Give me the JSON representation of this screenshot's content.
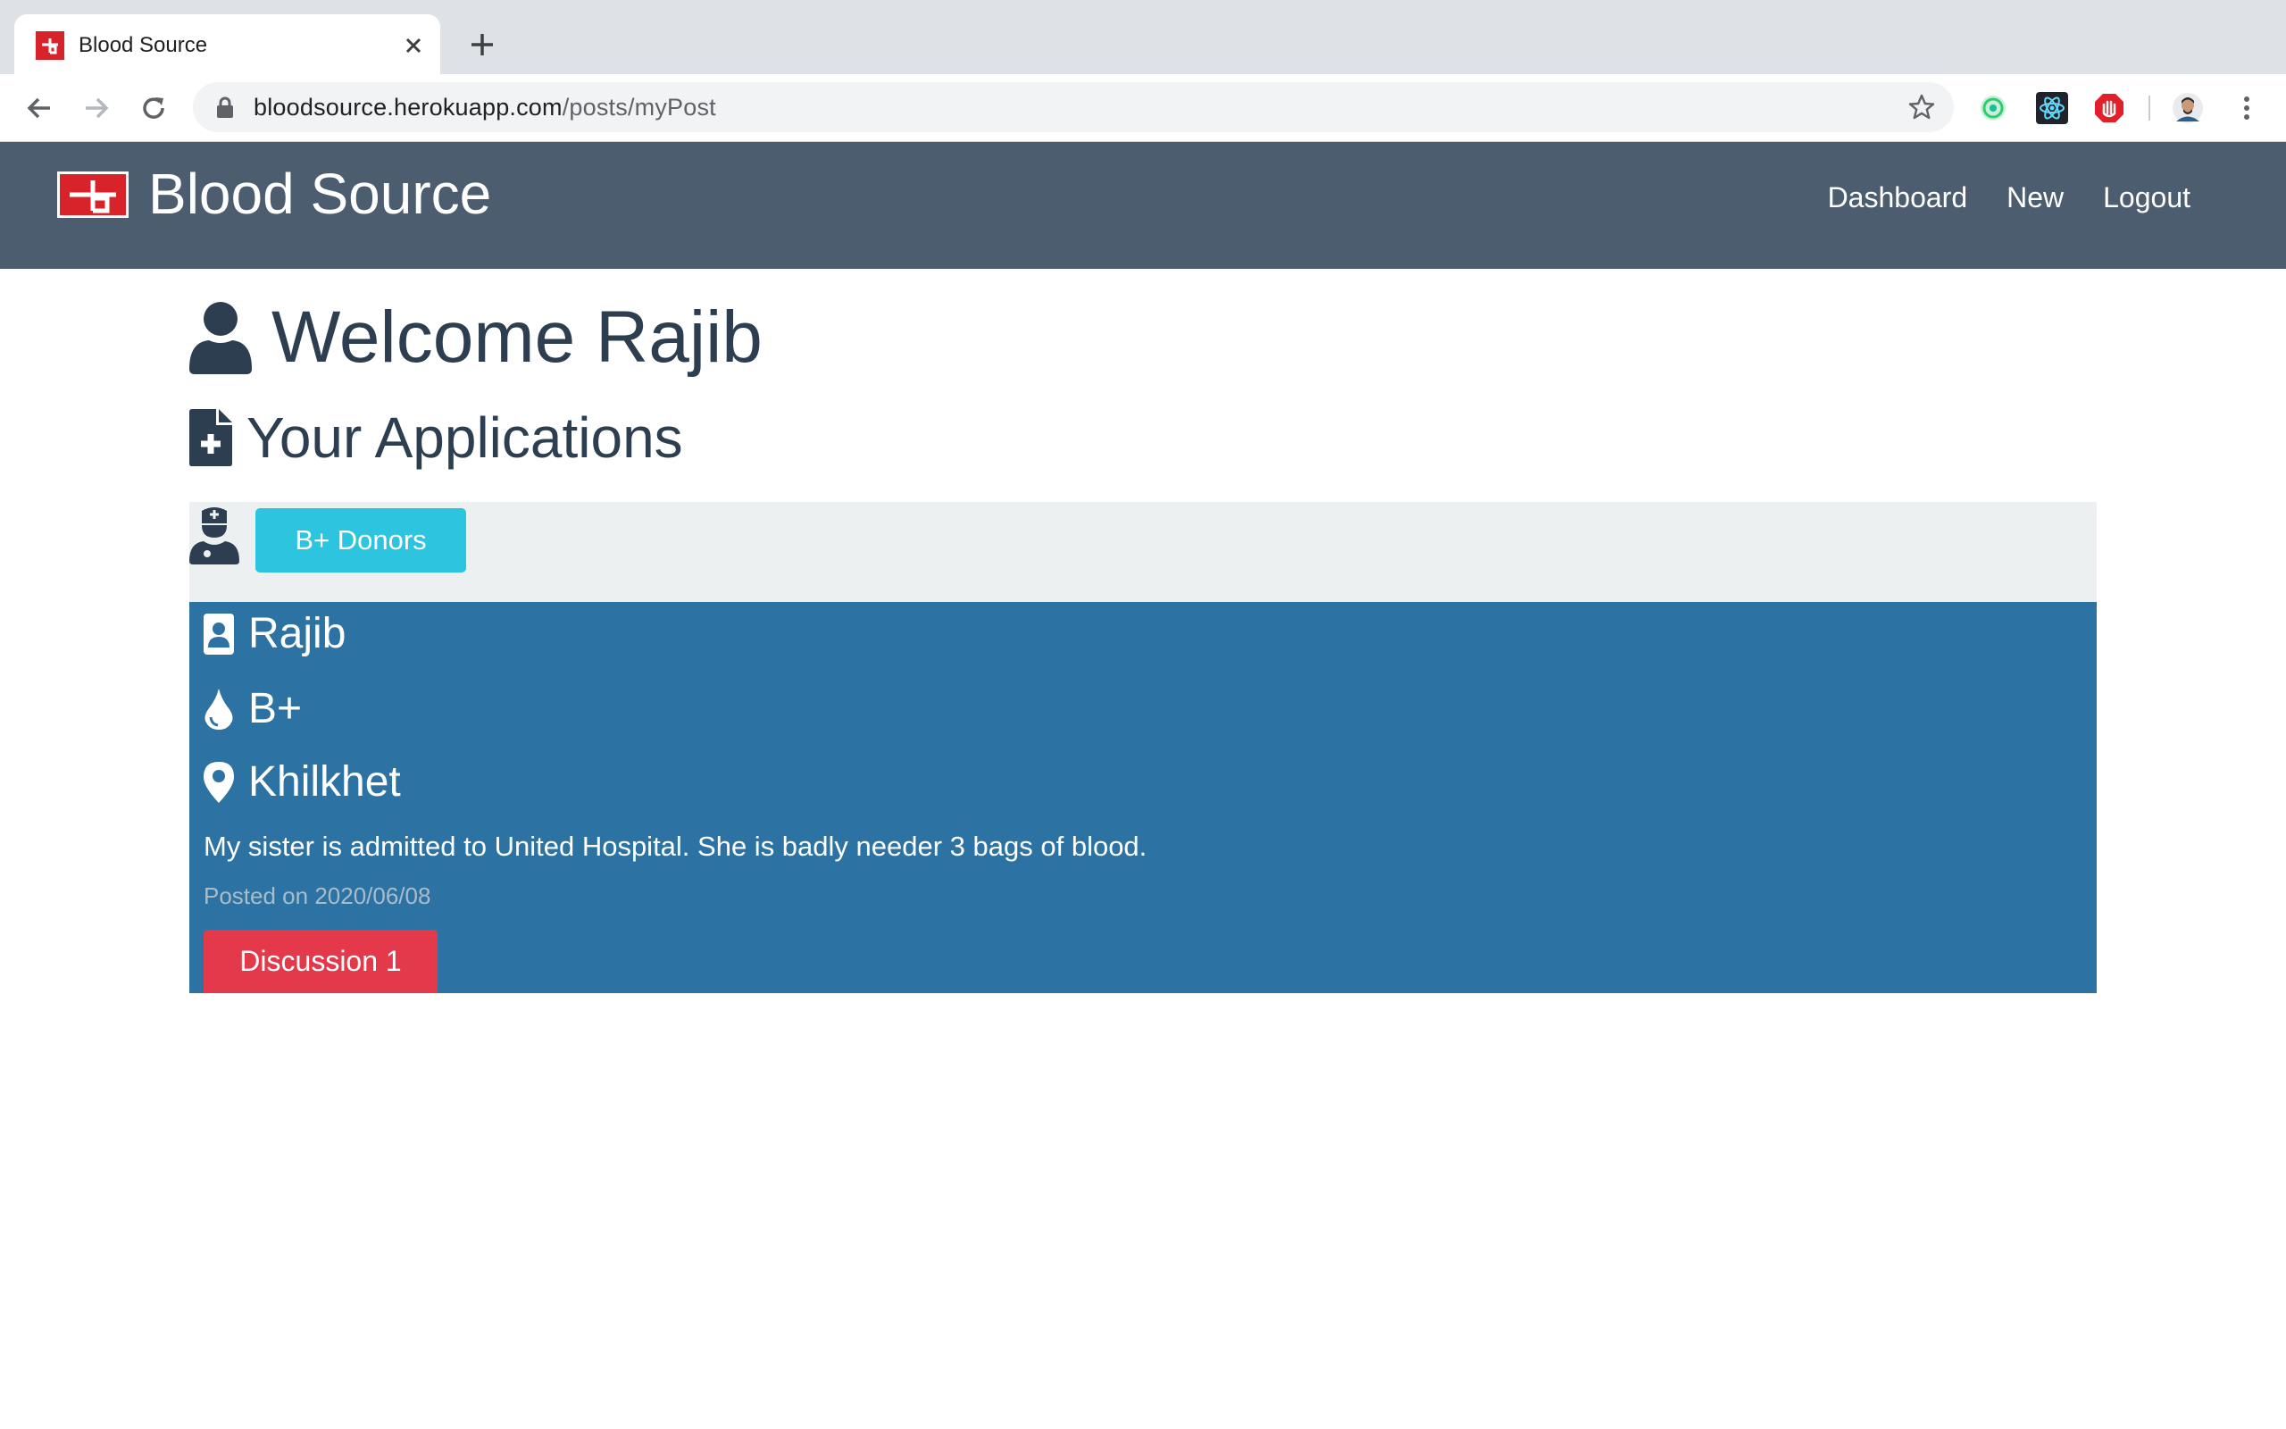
{
  "browser": {
    "tab_title": "Blood Source",
    "url_host": "bloodsource.herokuapp.com",
    "url_path": "/posts/myPost"
  },
  "navbar": {
    "brand": "Blood Source",
    "links": [
      "Dashboard",
      "New",
      "Logout"
    ]
  },
  "main": {
    "welcome": "Welcome Rajib",
    "section_title": "Your Applications"
  },
  "post": {
    "donors_button": "B+ Donors",
    "name": "Rajib",
    "blood_group": "B+",
    "location": "Khilkhet",
    "message": "My sister is admitted to United Hospital. She is badly needer 3 bags of blood.",
    "posted": "Posted on 2020/06/08",
    "discussion_button": "Discussion 1"
  },
  "colors": {
    "navbar_bg": "#4c5d70",
    "heading": "#2c3e50",
    "card_body": "#2c73a3",
    "card_header": "#ecf0f1",
    "info_button": "#2dc4e0",
    "danger_button": "#e3394b",
    "brand_red": "#d8232a"
  },
  "icons": [
    "user-icon",
    "file-medical-icon",
    "user-md-icon",
    "id-badge-icon",
    "tint-icon",
    "map-marker-icon"
  ]
}
